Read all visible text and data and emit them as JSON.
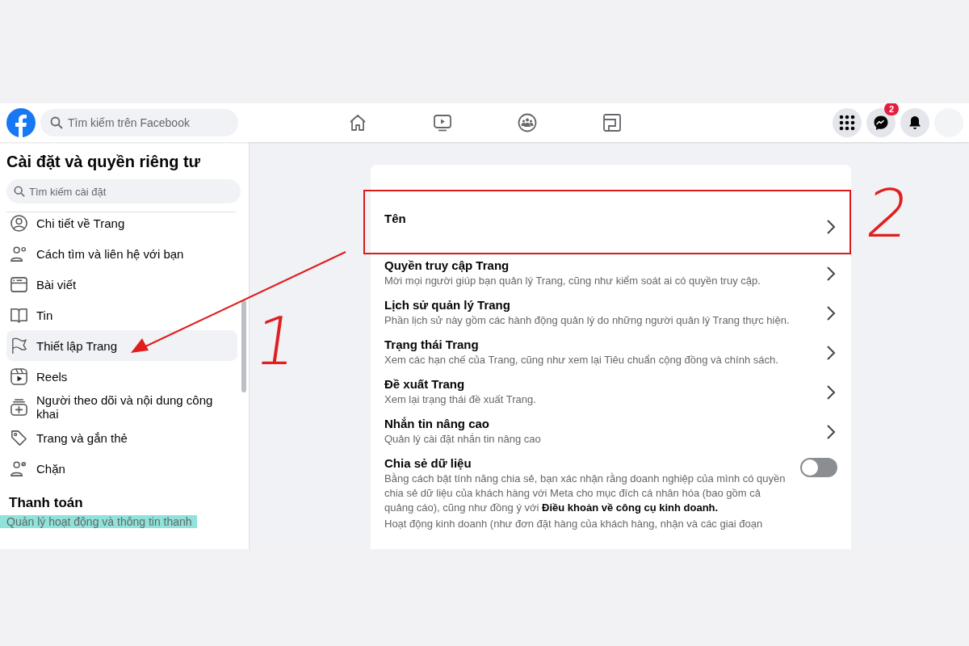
{
  "topbar": {
    "search": {
      "placeholder": "Tìm kiếm trên Facebook"
    },
    "nav": [
      {
        "selected": false
      },
      {
        "selected": false
      },
      {
        "selected": false
      },
      {
        "selected": false
      }
    ],
    "notifications_badge": "2"
  },
  "sidebar": {
    "title": "Cài đặt và quyền riêng tư",
    "search": {
      "placeholder": "Tìm kiếm cài đặt"
    },
    "items": [
      {
        "label": "Chi tiết về Trang",
        "selected": false
      },
      {
        "label": "Cách tìm và liên hệ với bạn",
        "selected": false
      },
      {
        "label": "Bài viết",
        "selected": false
      },
      {
        "label": "Tin",
        "selected": false
      },
      {
        "label": "Thiết lập Trang",
        "selected": true
      },
      {
        "label": "Reels",
        "selected": false
      },
      {
        "label": "Người theo dõi và nội dung công khai",
        "selected": false
      },
      {
        "label": "Trang và gắn thẻ",
        "selected": false
      },
      {
        "label": "Chặn",
        "selected": false
      }
    ],
    "section_title": "Thanh toán",
    "section_item": "Quản lý hoạt động và thông tin thanh"
  },
  "settings": [
    {
      "kind": "link",
      "title": "Tên"
    },
    {
      "kind": "link",
      "title": "Quyền truy cập Trang",
      "description": "Mời mọi người giúp bạn quản lý Trang, cũng như kiểm soát ai có quyền truy cập."
    },
    {
      "kind": "link",
      "title": "Lịch sử quản lý Trang",
      "description": "Phần lịch sử này gồm các hành động quản lý do những người quản lý Trang thực hiện."
    },
    {
      "kind": "link",
      "title": "Trạng thái Trang",
      "description": "Xem các hạn chế của Trang, cũng như xem lại Tiêu chuẩn cộng đồng và chính sách."
    },
    {
      "kind": "link",
      "title": "Đề xuất Trang",
      "description": "Xem lại trạng thái đề xuất Trang."
    },
    {
      "kind": "link",
      "title": "Nhắn tin nâng cao",
      "description": "Quản lý cài đặt nhắn tin nâng cao"
    },
    {
      "kind": "toggle",
      "title": "Chia sẻ dữ liệu",
      "on": false,
      "description": "Bằng cách bật tính năng chia sẻ, bạn xác nhận rằng doanh nghiệp của mình có quyền chia sẻ dữ liệu của khách hàng với Meta cho mục đích cá nhân hóa (bao gồm cả quảng cáo), cũng như đồng ý với **Điều khoản về công cụ kinh doanh.**",
      "more": "Hoạt động kinh doanh (như đơn đặt hàng của khách hàng, nhận và các giai đoạn"
    }
  ],
  "annotations": [
    {
      "kind": "arrow"
    },
    {
      "kind": "box"
    },
    {
      "kind": "label",
      "text": "1"
    },
    {
      "kind": "label",
      "text": "2"
    }
  ]
}
